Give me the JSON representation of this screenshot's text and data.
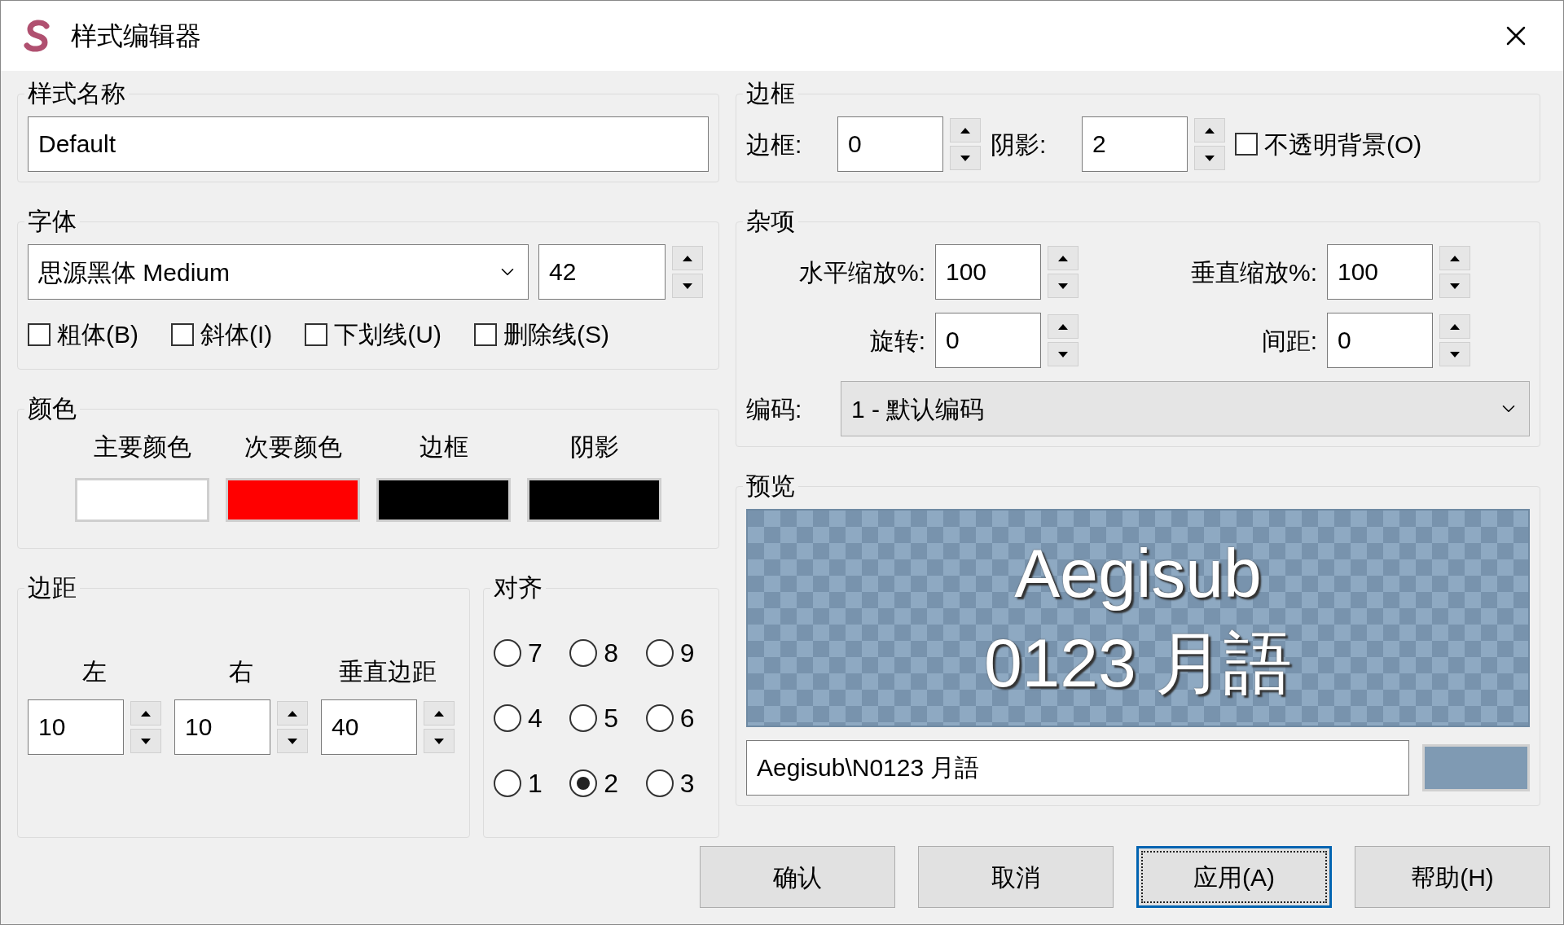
{
  "window": {
    "title": "样式编辑器"
  },
  "style_name": {
    "label": "样式名称",
    "value": "Default"
  },
  "font": {
    "label": "字体",
    "family": "思源黑体 Medium",
    "size": "42",
    "flags": [
      {
        "label": "粗体(B)",
        "checked": false
      },
      {
        "label": "斜体(I)",
        "checked": false
      },
      {
        "label": "下划线(U)",
        "checked": false
      },
      {
        "label": "删除线(S)",
        "checked": false
      }
    ]
  },
  "colors": {
    "label": "颜色",
    "swatches": [
      {
        "label": "主要颜色",
        "color": "#ffffff"
      },
      {
        "label": "次要颜色",
        "color": "#ff0000"
      },
      {
        "label": "边框",
        "color": "#000000"
      },
      {
        "label": "阴影",
        "color": "#000000"
      }
    ]
  },
  "margins": {
    "label": "边距",
    "fields": [
      {
        "label": "左",
        "value": "10"
      },
      {
        "label": "右",
        "value": "10"
      },
      {
        "label": "垂直边距",
        "value": "40"
      }
    ]
  },
  "alignment": {
    "label": "对齐",
    "options": [
      {
        "label": "7",
        "selected": false
      },
      {
        "label": "8",
        "selected": false
      },
      {
        "label": "9",
        "selected": false
      },
      {
        "label": "4",
        "selected": false
      },
      {
        "label": "5",
        "selected": false
      },
      {
        "label": "6",
        "selected": false
      },
      {
        "label": "1",
        "selected": false
      },
      {
        "label": "2",
        "selected": true
      },
      {
        "label": "3",
        "selected": false
      }
    ]
  },
  "border": {
    "label": "边框",
    "fields": [
      {
        "label": "边框:",
        "value": "0"
      },
      {
        "label": "阴影:",
        "value": "2"
      }
    ],
    "opaque": {
      "label": "不透明背景(O)",
      "checked": false
    }
  },
  "misc": {
    "label": "杂项",
    "fields": [
      {
        "label": "水平缩放%:",
        "value": "100"
      },
      {
        "label": "垂直缩放%:",
        "value": "100"
      },
      {
        "label": "旋转:",
        "value": "0"
      },
      {
        "label": "间距:",
        "value": "0"
      }
    ],
    "encoding": {
      "label": "编码:",
      "value": "1 - 默认编码"
    }
  },
  "preview": {
    "label": "预览",
    "lines": [
      "Aegisub",
      "0123 月語"
    ],
    "text": "Aegisub\\N0123 月語",
    "color": "#7f9ab3"
  },
  "buttons": [
    {
      "label": "确认",
      "focused": false
    },
    {
      "label": "取消",
      "focused": false
    },
    {
      "label": "应用(A)",
      "focused": true
    },
    {
      "label": "帮助(H)",
      "focused": false
    }
  ]
}
